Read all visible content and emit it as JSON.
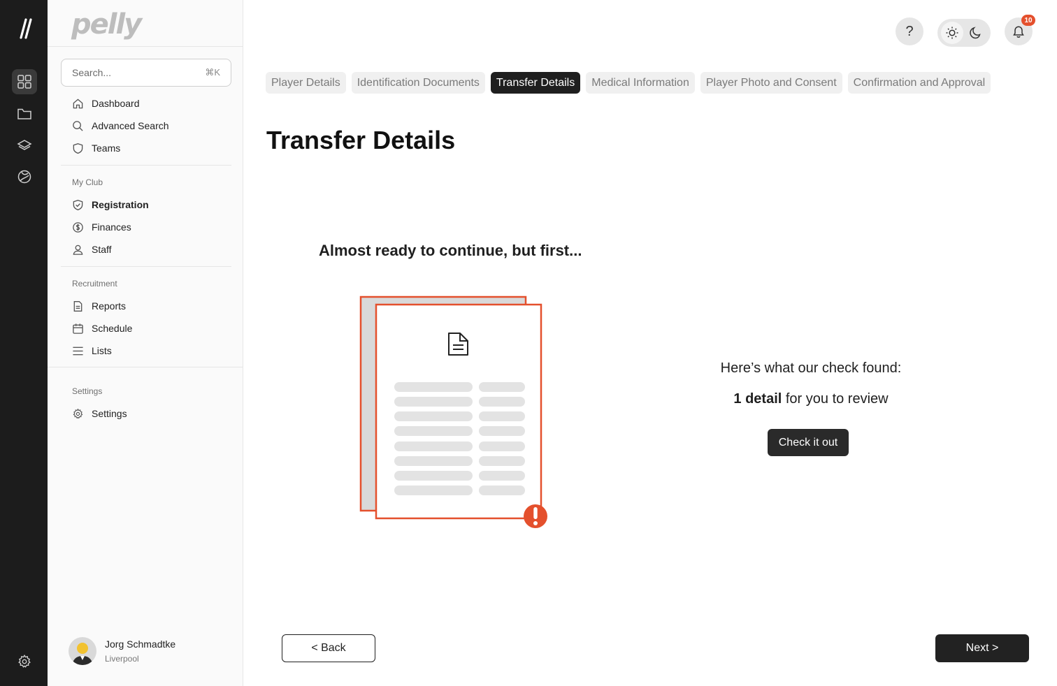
{
  "rail": {
    "logo": "//",
    "icons": [
      "grid-icon",
      "folder-icon",
      "layers-icon",
      "globe-icon",
      "gear-icon"
    ]
  },
  "sidebar": {
    "brand": "pelly",
    "search": {
      "placeholder": "Search...",
      "shortcut": "⌘K"
    },
    "main_items": [
      {
        "label": "Dashboard",
        "icon": "home-icon"
      },
      {
        "label": "Advanced Search",
        "icon": "search-icon"
      },
      {
        "label": "Teams",
        "icon": "shield-icon"
      }
    ],
    "my_club": {
      "label": "My Club",
      "items": [
        {
          "label": "Registration",
          "icon": "shield-check-icon",
          "active": true
        },
        {
          "label": "Finances",
          "icon": "dollar-icon"
        },
        {
          "label": "Staff",
          "icon": "user-icon"
        }
      ]
    },
    "recruitment": {
      "label": "Recruitment",
      "items": [
        {
          "label": "Reports",
          "icon": "document-icon"
        },
        {
          "label": "Schedule",
          "icon": "calendar-icon"
        },
        {
          "label": "Lists",
          "icon": "list-icon"
        }
      ]
    },
    "settings": {
      "label": "Settings",
      "items": [
        {
          "label": "Settings",
          "icon": "gear-icon"
        }
      ]
    },
    "user": {
      "name": "Jorg Schmadtke",
      "club": "Liverpool"
    }
  },
  "header": {
    "help": "?",
    "notifications_count": "10"
  },
  "tabs": [
    {
      "label": "Player Details"
    },
    {
      "label": "Identification Documents"
    },
    {
      "label": "Transfer Details",
      "active": true
    },
    {
      "label": "Medical Information"
    },
    {
      "label": "Player Photo and Consent"
    },
    {
      "label": "Confirmation and Approval"
    }
  ],
  "main": {
    "title": "Transfer Details",
    "subtitle": "Almost ready to continue, but first...",
    "found_text": "Here’s what our check found:",
    "review_count": "1 detail",
    "review_suffix": " for you to review",
    "check_button": "Check it out",
    "back_button": "< Back",
    "next_button": "Next >"
  },
  "colors": {
    "accent": "#e4502d",
    "rail": "#1c1c1c",
    "dark_button": "#222222"
  }
}
